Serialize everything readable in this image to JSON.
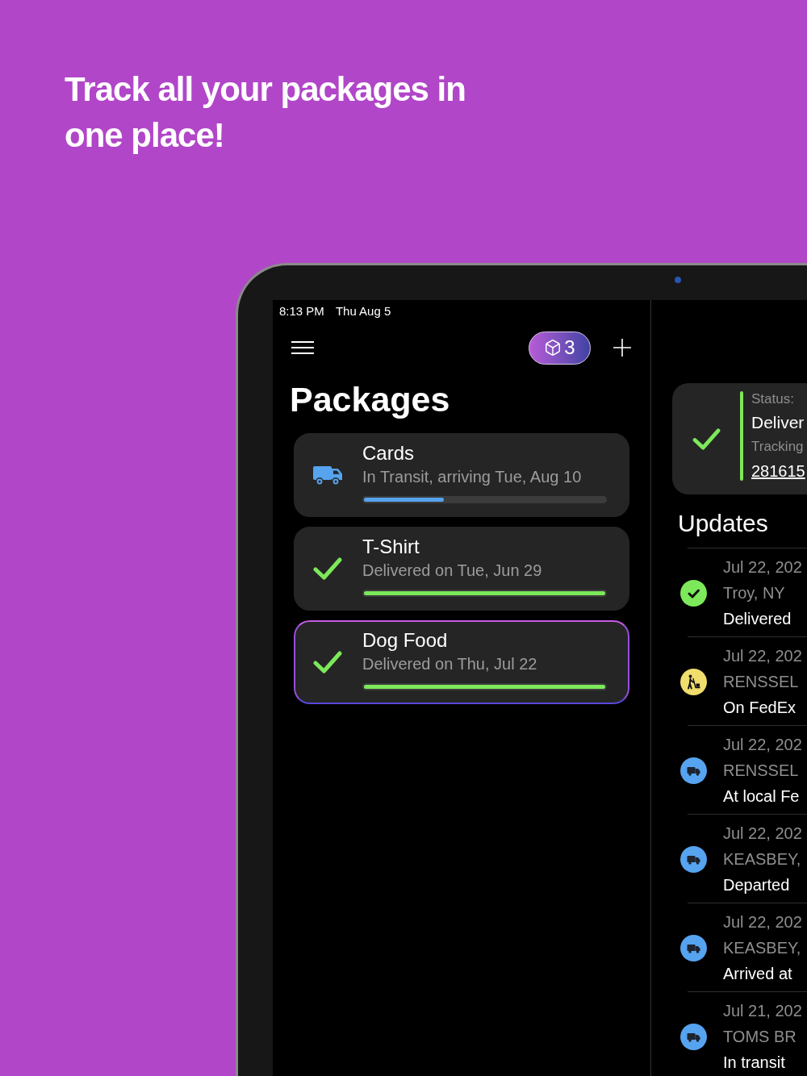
{
  "headline": "Track all your packages in one place!",
  "status_bar": {
    "time": "8:13 PM",
    "date": "Thu Aug 5"
  },
  "toolbar": {
    "package_count": "3"
  },
  "packages_list": {
    "title": "Packages",
    "packages": [
      {
        "name": "Cards",
        "status": "In Transit, arriving Tue, Aug 10",
        "kind": "in_transit",
        "level": 0.33,
        "selected": false
      },
      {
        "name": "T-Shirt",
        "status": "Delivered on Tue, Jun 29",
        "kind": "delivered",
        "level": 1,
        "selected": false
      },
      {
        "name": "Dog Food",
        "status": "Delivered on Thu, Jul 22",
        "kind": "delivered",
        "level": 1,
        "selected": true
      }
    ]
  },
  "detail": {
    "status_card": {
      "kind": "delivered",
      "status_label": "Status:",
      "status": "Deliver",
      "tracking_label": "Tracking",
      "tracking_number": "281615"
    },
    "updates_title": "Updates",
    "updates": [
      {
        "kind": "delivered",
        "date": "Jul 22, 202",
        "location": "Troy, NY",
        "description": "Delivered"
      },
      {
        "kind": "out_for_delivery",
        "date": "Jul 22, 202",
        "location": "RENSSEL",
        "description": "On FedEx"
      },
      {
        "kind": "in_transit",
        "date": "Jul 22, 202",
        "location": "RENSSEL",
        "description": "At local Fe"
      },
      {
        "kind": "in_transit",
        "date": "Jul 22, 202",
        "location": "KEASBEY,",
        "description": "Departed"
      },
      {
        "kind": "in_transit",
        "date": "Jul 22, 202",
        "location": "KEASBEY,",
        "description": "Arrived at"
      },
      {
        "kind": "in_transit",
        "date": "Jul 21, 202",
        "location": "TOMS BR",
        "description": "In transit"
      }
    ]
  }
}
